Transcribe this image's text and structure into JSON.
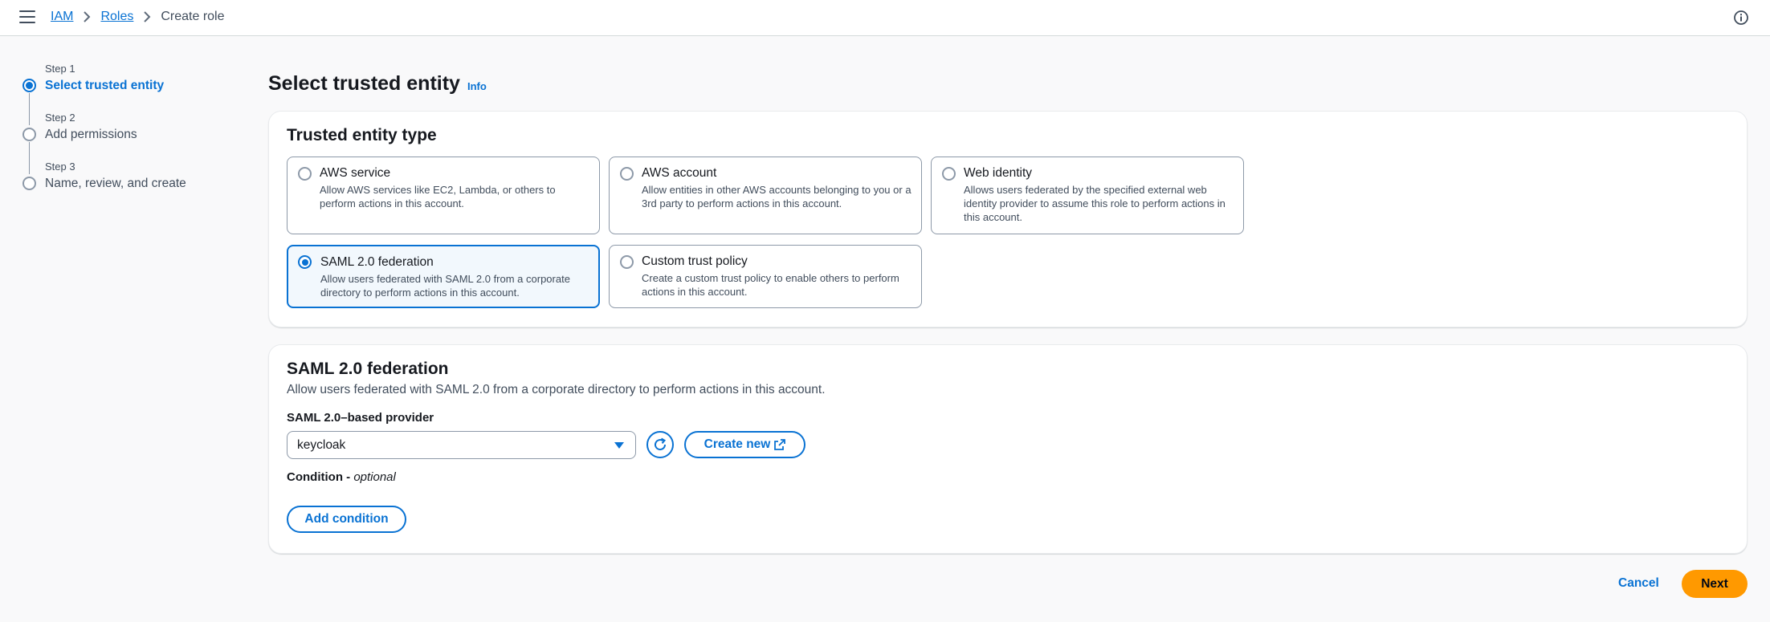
{
  "header": {
    "breadcrumb": {
      "iam": "IAM",
      "roles": "Roles",
      "current": "Create role"
    }
  },
  "steps": [
    {
      "num": "Step 1",
      "title": "Select trusted entity"
    },
    {
      "num": "Step 2",
      "title": "Add permissions"
    },
    {
      "num": "Step 3",
      "title": "Name, review, and create"
    }
  ],
  "page": {
    "title": "Select trusted entity",
    "info": "Info"
  },
  "trusted_entity": {
    "heading": "Trusted entity type",
    "options": [
      {
        "title": "AWS service",
        "desc": "Allow AWS services like EC2, Lambda, or others to perform actions in this account."
      },
      {
        "title": "AWS account",
        "desc": "Allow entities in other AWS accounts belonging to you or a 3rd party to perform actions in this account."
      },
      {
        "title": "Web identity",
        "desc": "Allows users federated by the specified external web identity provider to assume this role to perform actions in this account."
      },
      {
        "title": "SAML 2.0 federation",
        "desc": "Allow users federated with SAML 2.0 from a corporate directory to perform actions in this account."
      },
      {
        "title": "Custom trust policy",
        "desc": "Create a custom trust policy to enable others to perform actions in this account."
      }
    ],
    "selected": "SAML 2.0 federation"
  },
  "saml": {
    "heading": "SAML 2.0 federation",
    "description": "Allow users federated with SAML 2.0 from a corporate directory to perform actions in this account.",
    "provider_label": "SAML 2.0–based provider",
    "provider_value": "keycloak",
    "create_new": "Create new",
    "condition_label": "Condition -",
    "condition_optional": "optional",
    "add_condition": "Add condition"
  },
  "footer": {
    "cancel": "Cancel",
    "next": "Next"
  },
  "colors": {
    "accent": "#0972d3",
    "primary_button": "#ff9900"
  }
}
